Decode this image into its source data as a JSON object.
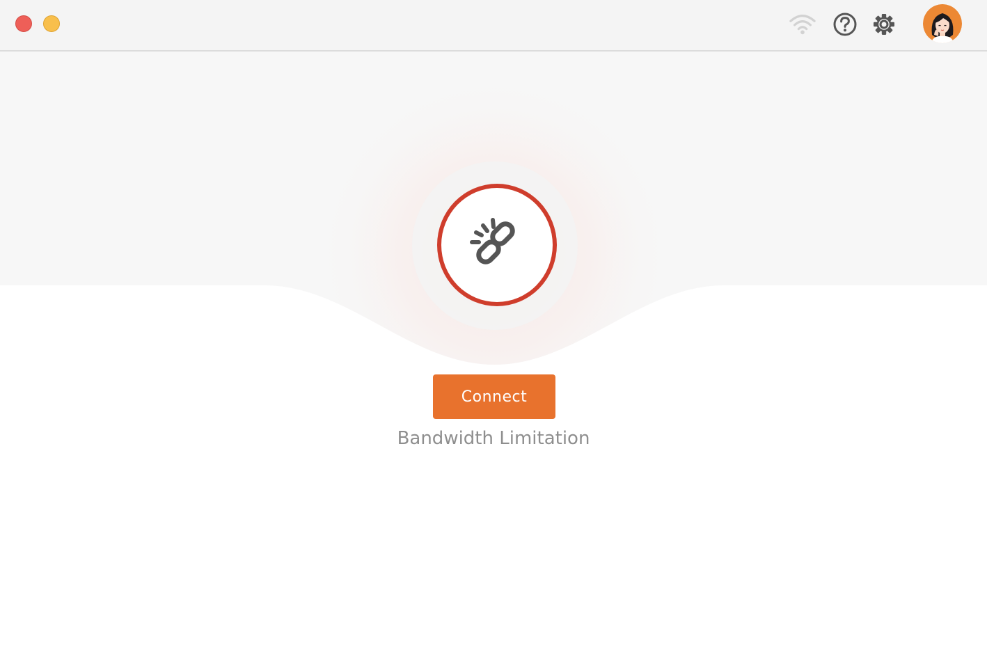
{
  "window": {
    "controls": [
      "close",
      "minimize"
    ]
  },
  "toolbar": {
    "icons": [
      "wifi-icon",
      "help-icon",
      "gear-icon"
    ],
    "avatar": "user-avatar"
  },
  "main": {
    "status_icon": "broken-link-icon",
    "connect_label": "Connect",
    "status_text": "Bandwidth Limitation"
  },
  "colors": {
    "accent": "#e8722d",
    "error_ring": "#cf3d2c",
    "status_text": "#8e8e8e",
    "titlebar_bg": "#f4f4f4",
    "hero_bg": "#f7f7f7"
  }
}
